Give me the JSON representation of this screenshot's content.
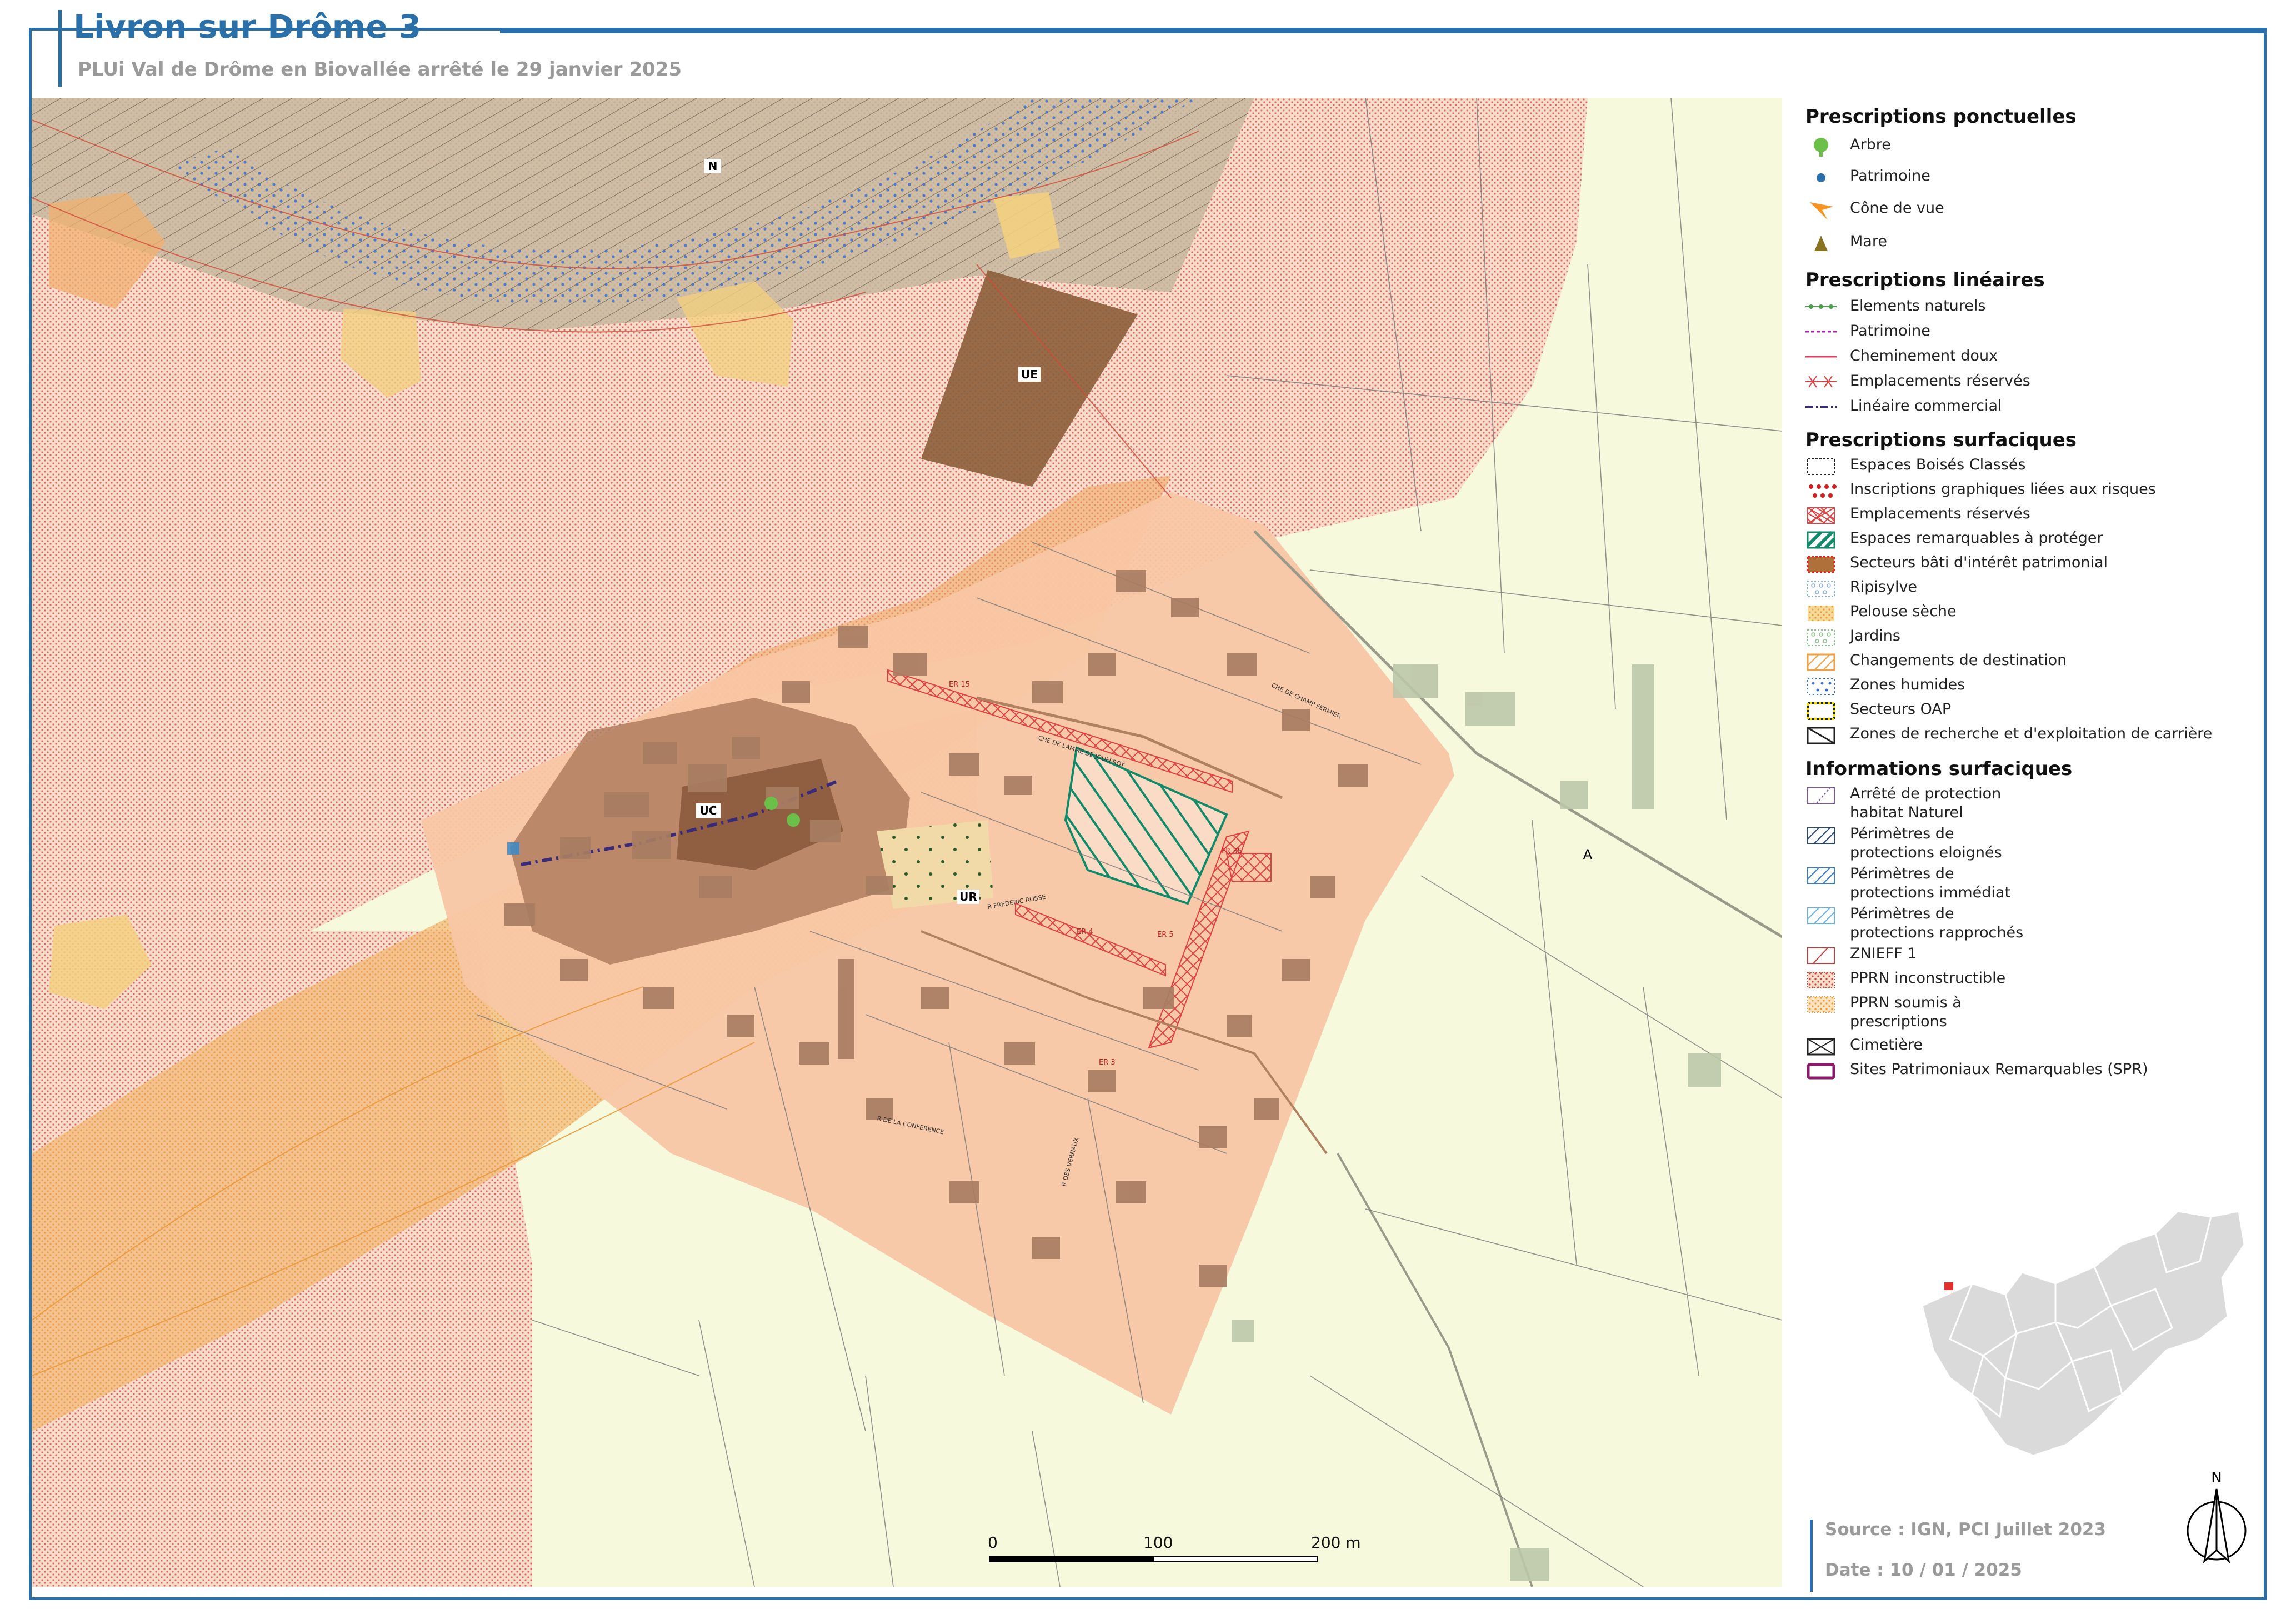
{
  "header": {
    "title": "Livron sur Drôme 3",
    "subtitle": "PLUi Val de Drôme en Biovallée arrêté le 29 janvier 2025"
  },
  "map_labels": {
    "zone_n": "N",
    "zone_ue": "UE",
    "zone_uc": "UC",
    "zone_ur": "UR",
    "zone_a": "A",
    "er_15": "ER 15",
    "er_35": "ER 35",
    "er_4": "ER 4",
    "er_5": "ER 5",
    "er_3": "ER 3",
    "street_champ_fermier": "CHE DE CHAMP FERMIER",
    "street_lamme": "CHE DE LAMME DE JOUFFROY",
    "street_frederic": "R FREDERIC ROSSE",
    "street_conference": "R DE LA CONFERENCE",
    "street_vernaux": "R DES VERNAUX"
  },
  "legend": {
    "ponctuelles": {
      "title": "Prescriptions ponctuelles",
      "items": [
        "Arbre",
        "Patrimoine",
        "Cône de vue",
        "Mare"
      ]
    },
    "lineaires": {
      "title": "Prescriptions linéaires",
      "items": [
        "Elements naturels",
        "Patrimoine",
        "Cheminement doux",
        "Emplacements réservés",
        "Linéaire commercial"
      ]
    },
    "surfaciques": {
      "title": "Prescriptions surfaciques",
      "items": [
        "Espaces Boisés Classés",
        "Inscriptions graphiques liées aux risques",
        "Emplacements réservés",
        "Espaces remarquables à protéger",
        "Secteurs bâti d'intérêt patrimonial",
        "Ripisylve",
        "Pelouse sèche",
        "Jardins",
        "Changements de destination",
        "Zones humides",
        "Secteurs OAP",
        "Zones de recherche et d'exploitation de carrière"
      ]
    },
    "informations": {
      "title": "Informations surfaciques",
      "items": [
        "Arrêté de protection habitat Naturel",
        "Périmètres de protections eloignés",
        "Périmètres de protections immédiat",
        "Périmètres de protections rapprochés",
        "ZNIEFF 1",
        "PPRN inconstructible",
        "PPRN soumis à prescriptions",
        "Cimetière",
        "Sites Patrimoniaux Remarquables (SPR)"
      ]
    }
  },
  "scale": {
    "t0": "0",
    "t1": "100",
    "t2": "200 m"
  },
  "north_label": "N",
  "footer": {
    "source": "Source : IGN, PCI Juillet 2023",
    "date": "Date : 10 / 01 / 2025"
  },
  "colors": {
    "frame": "#2a6fa8",
    "agri": "#f6f9dc",
    "urban": "#f8c9a6",
    "ppr_orange": "#f5b060",
    "ppr_red": "#d24a3a",
    "building": "#a87d62",
    "er": "#e04040",
    "espaces_remarquables": "#118a6a"
  }
}
